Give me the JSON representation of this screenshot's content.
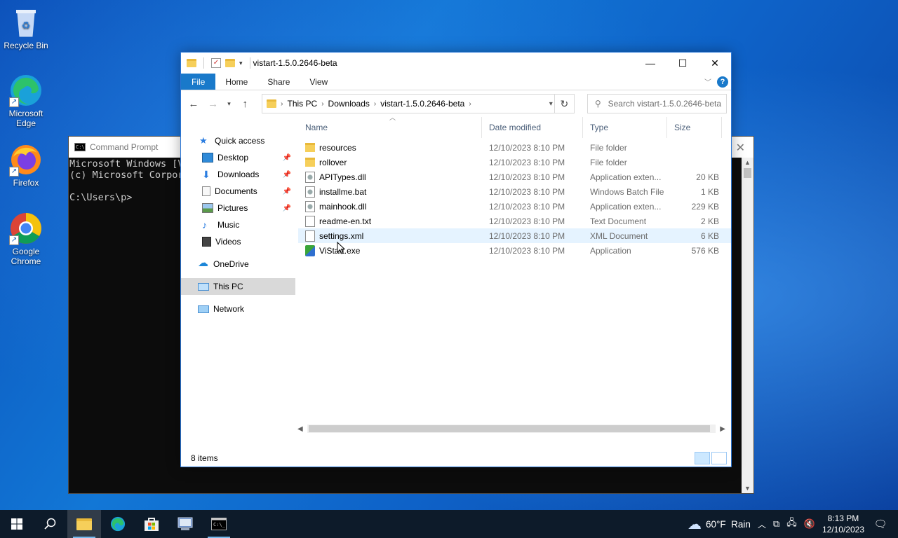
{
  "desktop": {
    "icons": [
      {
        "label": "Recycle Bin",
        "icon": "recycle-bin-icon"
      },
      {
        "label": "Microsoft Edge",
        "icon": "edge-icon"
      },
      {
        "label": "Firefox",
        "icon": "firefox-icon"
      },
      {
        "label": "Google Chrome",
        "icon": "chrome-icon"
      }
    ]
  },
  "cmd": {
    "title": "Command Prompt",
    "lines": [
      "Microsoft Windows [V",
      "(c) Microsoft Corpor",
      "",
      "C:\\Users\\p>"
    ]
  },
  "explorer": {
    "title": "vistart-1.5.0.2646-beta",
    "ribbon_tabs": [
      "File",
      "Home",
      "Share",
      "View"
    ],
    "breadcrumb": [
      "This PC",
      "Downloads",
      "vistart-1.5.0.2646-beta"
    ],
    "search_placeholder": "Search vistart-1.5.0.2646-beta",
    "nav": {
      "quick_access": "Quick access",
      "pinned": [
        "Desktop",
        "Downloads",
        "Documents",
        "Pictures"
      ],
      "unpinned": [
        "Music",
        "Videos"
      ],
      "onedrive": "OneDrive",
      "this_pc": "This PC",
      "network": "Network"
    },
    "columns": {
      "name": "Name",
      "date": "Date modified",
      "type": "Type",
      "size": "Size"
    },
    "files": [
      {
        "name": "resources",
        "date": "12/10/2023 8:10 PM",
        "type": "File folder",
        "size": "",
        "kind": "folder"
      },
      {
        "name": "rollover",
        "date": "12/10/2023 8:10 PM",
        "type": "File folder",
        "size": "",
        "kind": "folder"
      },
      {
        "name": "APITypes.dll",
        "date": "12/10/2023 8:10 PM",
        "type": "Application exten...",
        "size": "20 KB",
        "kind": "gear"
      },
      {
        "name": "installme.bat",
        "date": "12/10/2023 8:10 PM",
        "type": "Windows Batch File",
        "size": "1 KB",
        "kind": "gear"
      },
      {
        "name": "mainhook.dll",
        "date": "12/10/2023 8:10 PM",
        "type": "Application exten...",
        "size": "229 KB",
        "kind": "gear"
      },
      {
        "name": "readme-en.txt",
        "date": "12/10/2023 8:10 PM",
        "type": "Text Document",
        "size": "2 KB",
        "kind": "doc"
      },
      {
        "name": "settings.xml",
        "date": "12/10/2023 8:10 PM",
        "type": "XML Document",
        "size": "6 KB",
        "kind": "doc"
      },
      {
        "name": "ViStart.exe",
        "date": "12/10/2023 8:10 PM",
        "type": "Application",
        "size": "576 KB",
        "kind": "app"
      }
    ],
    "status": "8 items"
  },
  "taskbar": {
    "weather": "60°F  Rain",
    "time": "8:13 PM",
    "date": "12/10/2023"
  },
  "colors": {
    "accent": "#1979ca",
    "taskbar": "#0d1b2a"
  }
}
